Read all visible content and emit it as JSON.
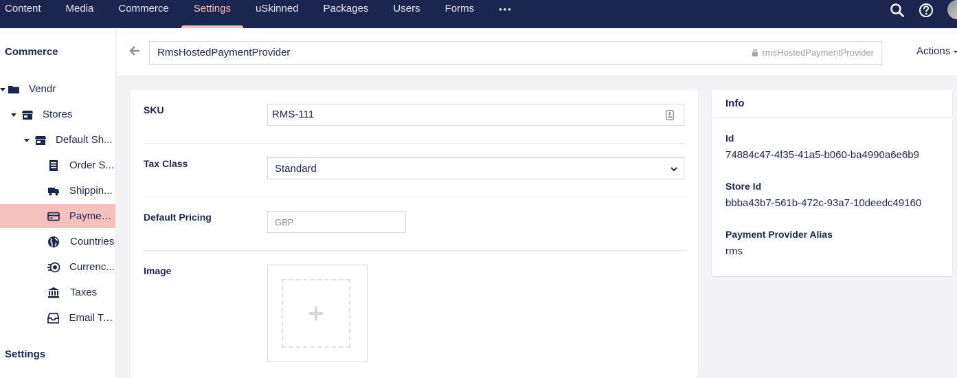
{
  "topnav": {
    "items": [
      {
        "label": "Content"
      },
      {
        "label": "Media"
      },
      {
        "label": "Commerce"
      },
      {
        "label": "Settings"
      },
      {
        "label": "uSkinned"
      },
      {
        "label": "Packages"
      },
      {
        "label": "Users"
      },
      {
        "label": "Forms"
      }
    ],
    "more_label": "•••",
    "active": "Settings"
  },
  "sidebar": {
    "section_title": "Commerce",
    "tree": [
      {
        "label": "Vendr",
        "icon": "folder-icon"
      },
      {
        "label": "Stores",
        "icon": "store-icon"
      },
      {
        "label": "Default Sh...",
        "icon": "store-icon"
      },
      {
        "label": "Order S...",
        "icon": "document-icon"
      },
      {
        "label": "Shippin...",
        "icon": "truck-icon"
      },
      {
        "label": "Paymen...",
        "icon": "credit-card-icon"
      },
      {
        "label": "Countries",
        "icon": "globe-icon"
      },
      {
        "label": "Currenc...",
        "icon": "coins-icon"
      },
      {
        "label": "Taxes",
        "icon": "bank-icon"
      },
      {
        "label": "Email Te...",
        "icon": "inbox-icon"
      }
    ],
    "settings_title": "Settings"
  },
  "header": {
    "name": "RmsHostedPaymentProvider",
    "alias": "rmsHostedPaymentProvider",
    "actions_label": "Actions"
  },
  "form": {
    "sku_label": "SKU",
    "sku_value": "RMS-111",
    "tax_class_label": "Tax Class",
    "tax_class_value": "Standard",
    "default_pricing_label": "Default Pricing",
    "default_pricing_placeholder": "GBP",
    "image_label": "Image"
  },
  "info": {
    "title": "Info",
    "id_label": "Id",
    "id_value": "74884c47-4f35-41a5-b060-ba4990a6e6b9",
    "store_id_label": "Store Id",
    "store_id_value": "bbba43b7-561b-472c-93a7-10deedc49160",
    "alias_label": "Payment Provider Alias",
    "alias_value": "rms"
  },
  "colors": {
    "topbar": "#1b264f",
    "active_accent": "#f5c1bc",
    "selected_row": "#f5c1bc",
    "text": "#1b264f"
  }
}
